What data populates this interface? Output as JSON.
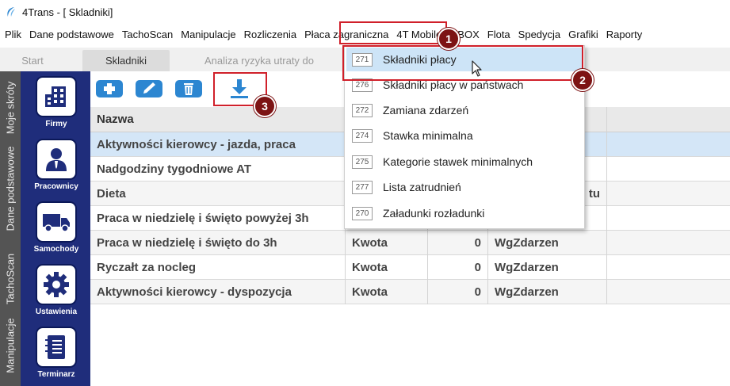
{
  "window": {
    "title": "4Trans - [ Skladniki]"
  },
  "menu": [
    "Plik",
    "Dane podstawowe",
    "TachoScan",
    "Manipulacje",
    "Rozliczenia",
    "Płaca zagraniczna",
    "4T Mobile",
    "GBOX",
    "Flota",
    "Spedycja",
    "Grafiki",
    "Raporty"
  ],
  "tabs": [
    "Start",
    "Skladniki",
    "Analiza ryzyka utraty do"
  ],
  "sidebar": {
    "vertical_tabs": [
      "Moje skróty",
      "Dane podstawowe",
      "TachoScan",
      "Manipulacje"
    ],
    "buttons": [
      {
        "label": "Firmy",
        "icon": "building-icon"
      },
      {
        "label": "Pracownicy",
        "icon": "person-icon"
      },
      {
        "label": "Samochody",
        "icon": "truck-icon"
      },
      {
        "label": "Ustawienia",
        "icon": "gear-icon"
      },
      {
        "label": "Terminarz",
        "icon": "notebook-icon"
      }
    ]
  },
  "toolbar": {
    "buttons": [
      {
        "name": "add",
        "icon": "add-icon"
      },
      {
        "name": "edit",
        "icon": "pencil-icon"
      },
      {
        "name": "delete",
        "icon": "trash-icon"
      },
      {
        "name": "download",
        "icon": "download-icon"
      }
    ]
  },
  "grid": {
    "columns": [
      "Nazwa",
      "",
      "",
      "",
      ""
    ],
    "rows": [
      [
        "Aktywności kierowcy - jazda, praca",
        "",
        "",
        "",
        ""
      ],
      [
        "Nadgodziny tygodniowe AT",
        "",
        "",
        "",
        ""
      ],
      [
        "Dieta",
        "",
        "",
        "tu",
        ""
      ],
      [
        "Praca w niedzielę i święto powyżej 3h",
        "",
        "",
        "",
        ""
      ],
      [
        "Praca w niedzielę i święto do 3h",
        "Kwota",
        "0",
        "WgZdarzen",
        ""
      ],
      [
        "Ryczałt za nocleg",
        "Kwota",
        "0",
        "WgZdarzen",
        ""
      ],
      [
        "Aktywności kierowcy - dyspozycja",
        "Kwota",
        "0",
        "WgZdarzen",
        ""
      ]
    ]
  },
  "dropdown": {
    "items": [
      {
        "code": "271",
        "label": "Składniki płacy"
      },
      {
        "code": "276",
        "label": "Składniki płacy w państwach"
      },
      {
        "code": "272",
        "label": "Zamiana zdarzeń"
      },
      {
        "code": "274",
        "label": "Stawka minimalna"
      },
      {
        "code": "275",
        "label": "Kategorie stawek minimalnych"
      },
      {
        "code": "277",
        "label": "Lista zatrudnień"
      },
      {
        "code": "270",
        "label": "Załadunki rozładunki"
      }
    ]
  },
  "annotations": [
    "1",
    "2",
    "3"
  ],
  "colors": {
    "sidebar": "#1f2d7b",
    "strip": "#545454",
    "accent": "#2c86d1",
    "highlight": "#cde4f7",
    "annotation": "#d0202a",
    "badge": "#7d1314"
  }
}
